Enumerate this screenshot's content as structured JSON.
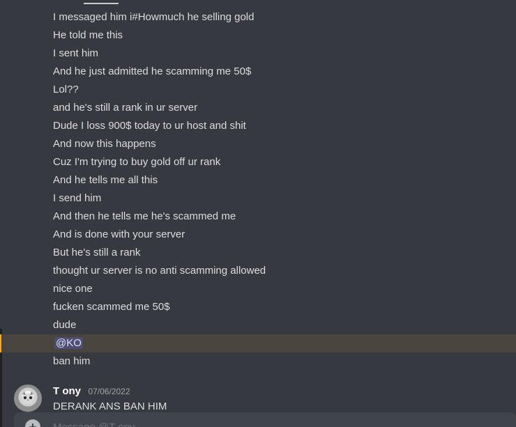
{
  "chat": {
    "messages": [
      "I messaged him i#Howmuch he selling gold",
      "He told me this",
      "I sent him",
      "And he just admitted he scamming me 50$",
      "Lol??",
      "and he's still a rank in ur server",
      "Dude I loss 900$ today to ur host and shit",
      "And now this happens",
      "Cuz I'm trying to buy gold off ur rank",
      "And he tells me all this",
      "I send him",
      "And then he tells me he's scammed me",
      "And is done with your server",
      "But he's still a rank",
      "thought ur server is no anti scamming allowed",
      "nice one",
      "fucken scammed me 50$",
      "dude",
      "@KO",
      "ban him"
    ],
    "last_message": {
      "author": "T ony",
      "timestamp": "07/06/2022",
      "text": "DERANK ANS BAN HIM"
    }
  },
  "composer": {
    "placeholder": "Message @T ony",
    "plus_icon": "+"
  },
  "colors": {
    "background": "#36393f",
    "text": "#dcddde",
    "mention_bg": "#49443c",
    "mention_accent": "#faa81a"
  }
}
